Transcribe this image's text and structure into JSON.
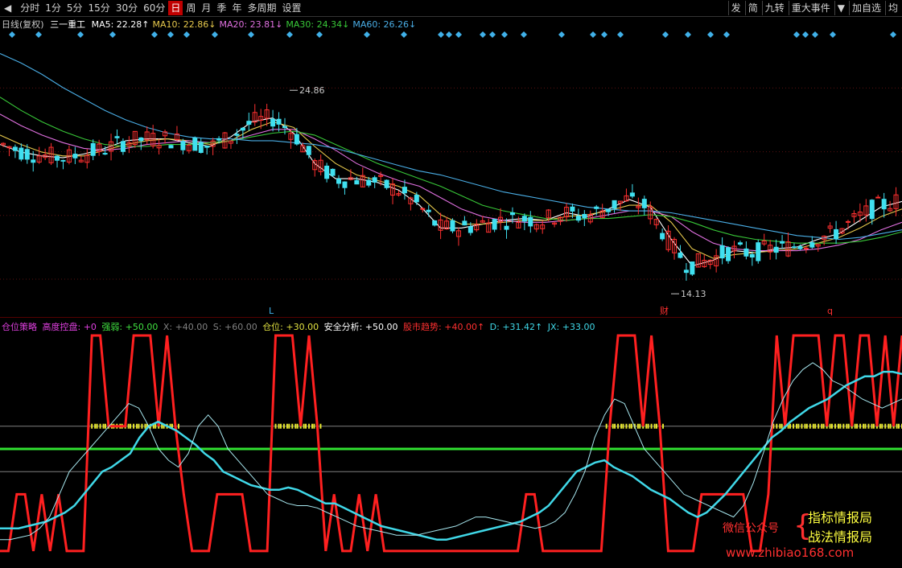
{
  "toolbar": {
    "left_arrow": "◀",
    "periods": [
      "分时",
      "1分",
      "5分",
      "15分",
      "30分",
      "60分",
      "日",
      "周",
      "月",
      "季",
      "年",
      "多周期",
      "设置"
    ],
    "active_period": "日",
    "right_items": [
      "发",
      "简",
      "九转",
      "重大事件",
      "▼",
      "加自选",
      "均"
    ]
  },
  "main_legend": {
    "period_label": "日线(复权)",
    "stock_name": "三一重工",
    "ma": [
      {
        "label": "MA5: 22.28↑",
        "color": "#ffffff"
      },
      {
        "label": "MA10: 22.86↓",
        "color": "#e6c84c"
      },
      {
        "label": "MA20: 23.81↓",
        "color": "#e070e0"
      },
      {
        "label": "MA30: 24.34↓",
        "color": "#38c838"
      },
      {
        "label": "MA60: 26.26↓",
        "color": "#4aaee6"
      }
    ]
  },
  "indicator_legend": {
    "items": [
      {
        "label": "仓位策略",
        "color": "#e040e0"
      },
      {
        "label": "高度控盘: +0",
        "color": "#e040e0"
      },
      {
        "label": "强弱: +50.00",
        "color": "#40e040"
      },
      {
        "label": "X: +40.00",
        "color": "#808080"
      },
      {
        "label": "S: +60.00",
        "color": "#808080"
      },
      {
        "label": "仓位: +30.00",
        "color": "#e0e040"
      },
      {
        "label": "安全分析: +50.00",
        "color": "#ffffff"
      },
      {
        "label": "股市趋势: +40.00↑",
        "color": "#ff3030"
      },
      {
        "label": "D: +31.42↑",
        "color": "#40d8e8"
      },
      {
        "label": "JX: +33.00",
        "color": "#40d8e8"
      }
    ]
  },
  "annotations": {
    "high_label": "24.86",
    "low_label": "14.13",
    "marker_L": "L",
    "marker_cai": "财",
    "marker_q": "q"
  },
  "watermark": {
    "wechat": "微信公众号",
    "brand1": "指标情报局",
    "brand2": "战法情报局",
    "url": "www.zhibiao168.com"
  },
  "chart_data": {
    "type": "line",
    "title": "三一重工 日线(复权)",
    "price_ylim": [
      13.5,
      27.5
    ],
    "high": 24.86,
    "low": 14.13,
    "ma_series": [
      {
        "name": "MA5",
        "color": "#ffffff",
        "values": [
          22.0,
          21.6,
          21.4,
          21.3,
          21.5,
          21.8,
          22.2,
          22.3,
          22.3,
          22.1,
          21.9,
          22.4,
          23.2,
          23.4,
          22.6,
          21.0,
          20.2,
          20.2,
          20.0,
          19.6,
          18.8,
          17.6,
          17.6,
          17.8,
          18.0,
          18.1,
          18.0,
          18.4,
          18.2,
          18.6,
          19.1,
          18.7,
          17.0,
          15.6,
          15.9,
          16.4,
          16.3,
          16.5,
          16.6,
          17.0,
          17.3,
          18.0,
          18.7,
          19.0
        ]
      },
      {
        "name": "MA10",
        "color": "#e6c84c",
        "values": [
          22.5,
          22.0,
          21.6,
          21.4,
          21.4,
          21.7,
          22.0,
          22.2,
          22.3,
          22.2,
          22.0,
          22.2,
          22.8,
          23.2,
          22.9,
          21.9,
          21.0,
          20.4,
          20.1,
          19.8,
          19.3,
          18.3,
          17.8,
          17.8,
          17.9,
          18.0,
          18.0,
          18.2,
          18.3,
          18.5,
          18.8,
          18.8,
          17.9,
          16.5,
          16.0,
          16.2,
          16.3,
          16.4,
          16.5,
          16.8,
          17.1,
          17.6,
          18.2,
          18.6
        ]
      },
      {
        "name": "MA20",
        "color": "#e070e0",
        "values": [
          23.6,
          23.0,
          22.5,
          22.1,
          21.8,
          21.7,
          21.8,
          22.0,
          22.1,
          22.2,
          22.1,
          22.2,
          22.5,
          22.8,
          22.8,
          22.3,
          21.7,
          21.0,
          20.5,
          20.1,
          19.8,
          19.2,
          18.6,
          18.2,
          18.0,
          17.9,
          17.9,
          18.0,
          18.1,
          18.3,
          18.5,
          18.5,
          18.2,
          17.4,
          16.8,
          16.5,
          16.4,
          16.4,
          16.4,
          16.5,
          16.7,
          17.0,
          17.5,
          17.9
        ]
      },
      {
        "name": "MA30",
        "color": "#38c838",
        "values": [
          24.5,
          23.8,
          23.2,
          22.7,
          22.3,
          22.0,
          21.9,
          21.9,
          22.0,
          22.0,
          22.1,
          22.2,
          22.4,
          22.6,
          22.7,
          22.5,
          22.0,
          21.5,
          21.0,
          20.6,
          20.2,
          19.8,
          19.3,
          18.8,
          18.5,
          18.3,
          18.1,
          18.0,
          18.1,
          18.1,
          18.2,
          18.3,
          18.2,
          17.9,
          17.5,
          17.2,
          17.0,
          16.9,
          16.8,
          16.8,
          16.8,
          16.9,
          17.1,
          17.4
        ]
      },
      {
        "name": "MA60",
        "color": "#4aaee6",
        "values": [
          26.8,
          26.3,
          25.7,
          25.0,
          24.4,
          23.8,
          23.3,
          22.9,
          22.6,
          22.4,
          22.3,
          22.3,
          22.2,
          22.2,
          22.1,
          22.0,
          21.8,
          21.5,
          21.2,
          20.9,
          20.6,
          20.4,
          20.1,
          19.8,
          19.5,
          19.3,
          19.1,
          18.9,
          18.7,
          18.6,
          18.5,
          18.5,
          18.4,
          18.2,
          18.0,
          17.8,
          17.6,
          17.4,
          17.2,
          17.1,
          17.0,
          17.1,
          17.3,
          17.5
        ]
      }
    ],
    "indicator_ylim": [
      0,
      100
    ],
    "indicator_levels": [
      {
        "name": "强弱",
        "value": 50,
        "color": "#30e030"
      },
      {
        "name": "X",
        "value": 40,
        "color": "#808080"
      },
      {
        "name": "S",
        "value": 60,
        "color": "#808080"
      }
    ],
    "indicator_series": [
      {
        "name": "股市趋势",
        "color": "#ff2020",
        "values": [
          5,
          5,
          30,
          30,
          5,
          30,
          5,
          30,
          5,
          5,
          5,
          100,
          100,
          60,
          60,
          60,
          100,
          100,
          100,
          60,
          100,
          60,
          30,
          5,
          5,
          5,
          30,
          30,
          30,
          30,
          5,
          5,
          5,
          100,
          100,
          100,
          60,
          100,
          60,
          5,
          30,
          5,
          5,
          30,
          5,
          30,
          5,
          5,
          5,
          5,
          5,
          5,
          5,
          5,
          5,
          5,
          5,
          5,
          5,
          5,
          5,
          5,
          5,
          30,
          30,
          5,
          5,
          5,
          5,
          5,
          5,
          5,
          5,
          60,
          100,
          100,
          100,
          60,
          100,
          60,
          5,
          5,
          5,
          5,
          30,
          30,
          30,
          30,
          30,
          30,
          5,
          5,
          30,
          100,
          60,
          100,
          100,
          100,
          100,
          60,
          100,
          100,
          60,
          100,
          100,
          60,
          100,
          60,
          100
        ]
      },
      {
        "name": "D",
        "color": "#40d8e8",
        "values": [
          15,
          15,
          15,
          16,
          17,
          18,
          20,
          22,
          25,
          30,
          35,
          40,
          42,
          45,
          48,
          55,
          60,
          62,
          60,
          58,
          55,
          52,
          48,
          45,
          40,
          38,
          36,
          34,
          33,
          32,
          32,
          33,
          32,
          30,
          28,
          26,
          26,
          24,
          22,
          20,
          18,
          16,
          15,
          14,
          13,
          12,
          11,
          10,
          10,
          11,
          12,
          13,
          14,
          15,
          16,
          17,
          18,
          20,
          22,
          25,
          30,
          35,
          40,
          42,
          44,
          45,
          42,
          40,
          38,
          35,
          32,
          30,
          28,
          25,
          22,
          20,
          22,
          26,
          30,
          35,
          40,
          45,
          50,
          55,
          58,
          62,
          65,
          68,
          70,
          72,
          75,
          78,
          80,
          82,
          82,
          84,
          84,
          83
        ]
      },
      {
        "name": "JX",
        "color": "#a8e8f0",
        "values": [
          10,
          10,
          11,
          12,
          15,
          20,
          30,
          40,
          45,
          50,
          55,
          60,
          65,
          70,
          68,
          60,
          50,
          45,
          42,
          48,
          60,
          65,
          60,
          50,
          45,
          40,
          35,
          30,
          28,
          26,
          25,
          25,
          24,
          22,
          20,
          18,
          16,
          15,
          14,
          13,
          12,
          12,
          12,
          13,
          14,
          15,
          16,
          18,
          20,
          20,
          19,
          18,
          17,
          16,
          15,
          16,
          18,
          22,
          30,
          40,
          55,
          65,
          72,
          70,
          60,
          50,
          45,
          40,
          35,
          30,
          28,
          26,
          24,
          22,
          20,
          25,
          35,
          48,
          62,
          72,
          80,
          85,
          88,
          85,
          80,
          78,
          75,
          72,
          70,
          68,
          70,
          72
        ]
      }
    ],
    "position_band": {
      "name": "仓位",
      "value": 60,
      "color": "#e8e830"
    }
  }
}
